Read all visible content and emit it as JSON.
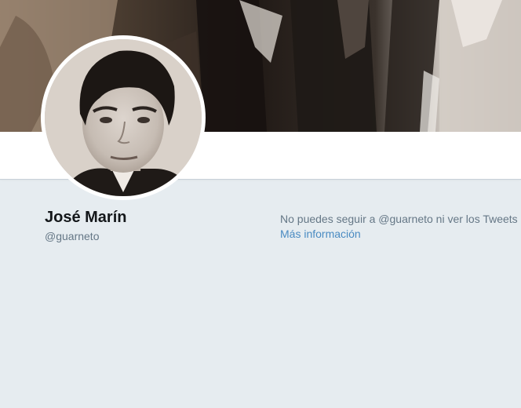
{
  "profile": {
    "name": "José Marín",
    "handle": "@guarneto"
  },
  "protected_notice": {
    "message": "No puedes seguir a @guarneto ni ver los Tweets de esta cuenta.",
    "link_label": "Más información"
  },
  "colors": {
    "page_background": "#e6ecf0",
    "link": "#4a8bc2",
    "name_text": "#14171a",
    "secondary_text": "#657786"
  }
}
